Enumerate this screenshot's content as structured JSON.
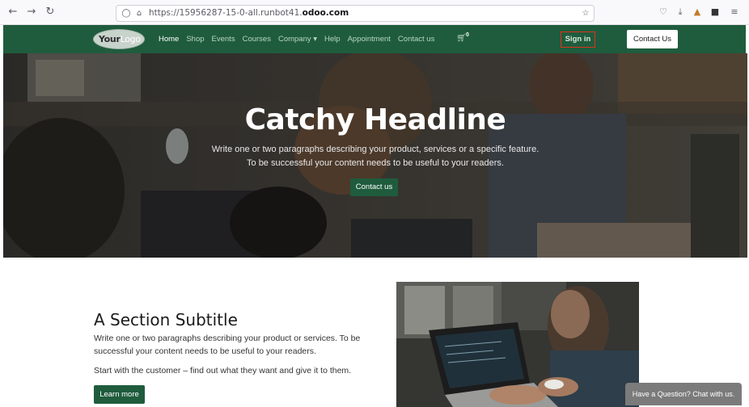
{
  "browser": {
    "url_prefix": "https://15956287-15-0-all.runbot41.",
    "url_domain": "odoo.com"
  },
  "header": {
    "logo_text_dark": "Your",
    "logo_text_light": "Logo",
    "menu": [
      {
        "label": "Home",
        "active": true
      },
      {
        "label": "Shop",
        "active": false
      },
      {
        "label": "Events",
        "active": false
      },
      {
        "label": "Courses",
        "active": false
      },
      {
        "label": "Company ▾",
        "active": false
      },
      {
        "label": "Help",
        "active": false
      },
      {
        "label": "Appointment",
        "active": false
      },
      {
        "label": "Contact us",
        "active": false
      }
    ],
    "cart_count": "0",
    "sign_in": "Sign in",
    "contact_button": "Contact Us"
  },
  "hero": {
    "title": "Catchy Headline",
    "line1": "Write one or two paragraphs describing your product, services or a specific feature.",
    "line2": "To be successful your content needs to be useful to your readers.",
    "cta": "Contact us"
  },
  "section": {
    "title": "A Section Subtitle",
    "para1_line1": "Write one or two paragraphs describing your product or services. To be",
    "para1_line2": "successful your content needs to be useful to your readers.",
    "para2": "Start with the customer – find out what they want and give it to them.",
    "button": "Learn more"
  },
  "chat": {
    "label": "Have a Question? Chat with us."
  },
  "colors": {
    "brand_green": "#1f5c3d",
    "signin_border": "#e0321e"
  }
}
